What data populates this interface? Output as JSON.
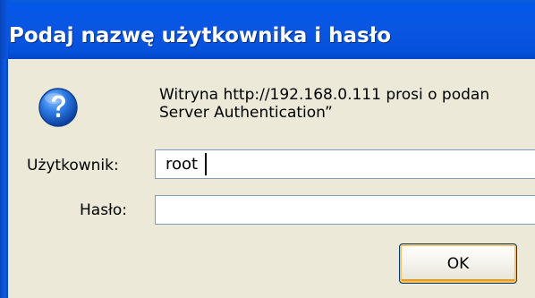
{
  "dialog": {
    "title": "Podaj nazwę użytkownika i hasło",
    "icon": "question-icon",
    "message_line1": "Witryna http://192.168.0.111 prosi o podan",
    "message_line2": "Server Authentication”",
    "username_label": "Użytkownik:",
    "username_value": "root",
    "password_label": "Hasło:",
    "password_value": "",
    "ok_label": "OK"
  },
  "colors": {
    "titlebar": "#0a56e2",
    "client_bg": "#ece9d8",
    "title_text": "#ffffff"
  }
}
